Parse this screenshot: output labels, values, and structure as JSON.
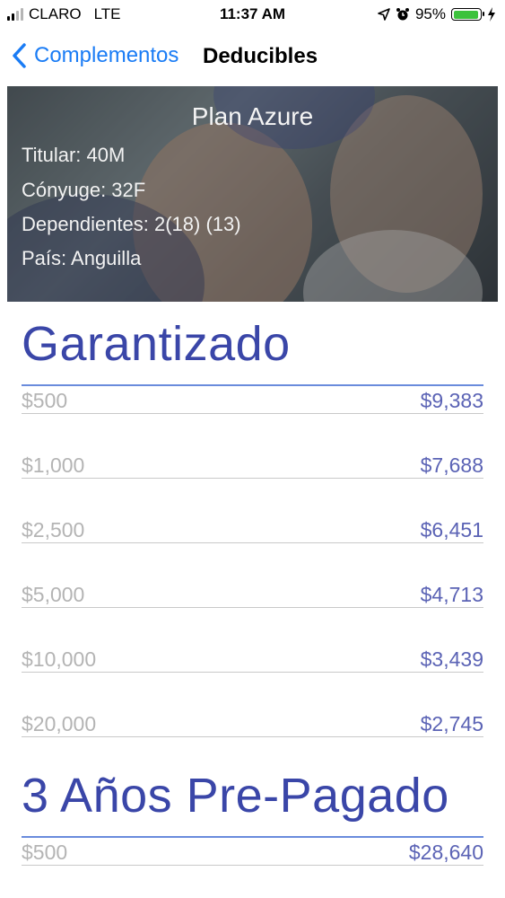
{
  "status_bar": {
    "carrier": "CLARO",
    "network": "LTE",
    "time": "11:37 AM",
    "battery_percent": "95%",
    "battery_level": 0.95
  },
  "nav": {
    "back_label": "Complementos",
    "title": "Deducibles"
  },
  "hero": {
    "plan_name": "Plan Azure",
    "titular": "Titular: 40M",
    "conyuge": "Cónyuge: 32F",
    "dependientes": "Dependientes: 2(18) (13)",
    "pais": "País: Anguilla"
  },
  "sections": [
    {
      "title": "Garantizado",
      "rows": [
        {
          "deductible": "$500",
          "price": "$9,383"
        },
        {
          "deductible": "$1,000",
          "price": "$7,688"
        },
        {
          "deductible": "$2,500",
          "price": "$6,451"
        },
        {
          "deductible": "$5,000",
          "price": "$4,713"
        },
        {
          "deductible": "$10,000",
          "price": "$3,439"
        },
        {
          "deductible": "$20,000",
          "price": "$2,745"
        }
      ]
    },
    {
      "title": "3 Años Pre-Pagado",
      "rows": [
        {
          "deductible": "$500",
          "price": "$28,640"
        }
      ]
    }
  ],
  "colors": {
    "accent": "#1a7cf5",
    "section_title": "#3a46a8",
    "price": "#5b63b5",
    "deductible": "#b4b4b4"
  }
}
